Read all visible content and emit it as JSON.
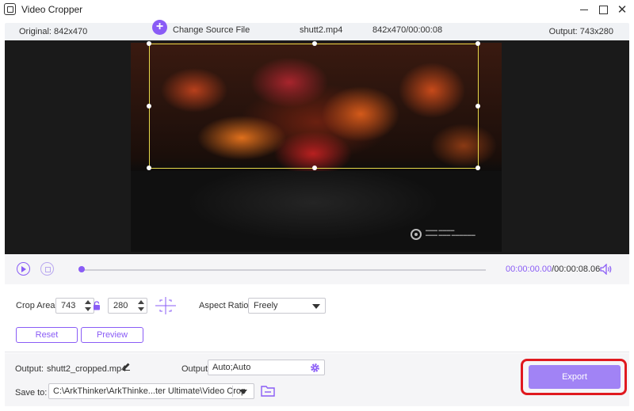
{
  "window": {
    "title": "Video Cropper",
    "close_glyph": "✕"
  },
  "info": {
    "original": "Original: 842x470",
    "add_glyph": "+",
    "change_source": "Change Source File",
    "file_name": "shutt2.mp4",
    "dimensions_duration": "842x470/00:00:08",
    "output": "Output: 743x280"
  },
  "playback": {
    "current_time": "00:00:00.00",
    "total_time": "/00:00:08.06",
    "progress": 0
  },
  "crop": {
    "area_label": "Crop Area:",
    "width": "743",
    "height": "280",
    "aspect_label": "Aspect Ratio:",
    "aspect_value": "Freely",
    "reset_label": "Reset",
    "preview_label": "Preview"
  },
  "output": {
    "output_label": "Output:",
    "file_name": "shutt2_cropped.mp4",
    "format_label": "Output:",
    "format_value": "Auto;Auto",
    "save_label": "Save to:",
    "save_path": "C:\\ArkThinker\\ArkThinke...ter Ultimate\\Video Crop",
    "export_label": "Export"
  },
  "colors": {
    "accent": "#8a5cf6",
    "crop_border": "#e6d94a",
    "highlight": "#e0191f",
    "export_bg": "#a183f5"
  },
  "icons": [
    "app-icon",
    "minimize-icon",
    "maximize-icon",
    "close-icon",
    "add-icon",
    "play-icon",
    "stop-icon",
    "volume-icon",
    "lock-icon",
    "center-crop-icon",
    "chevron-down-icon",
    "edit-icon",
    "gear-icon",
    "folder-icon"
  ]
}
